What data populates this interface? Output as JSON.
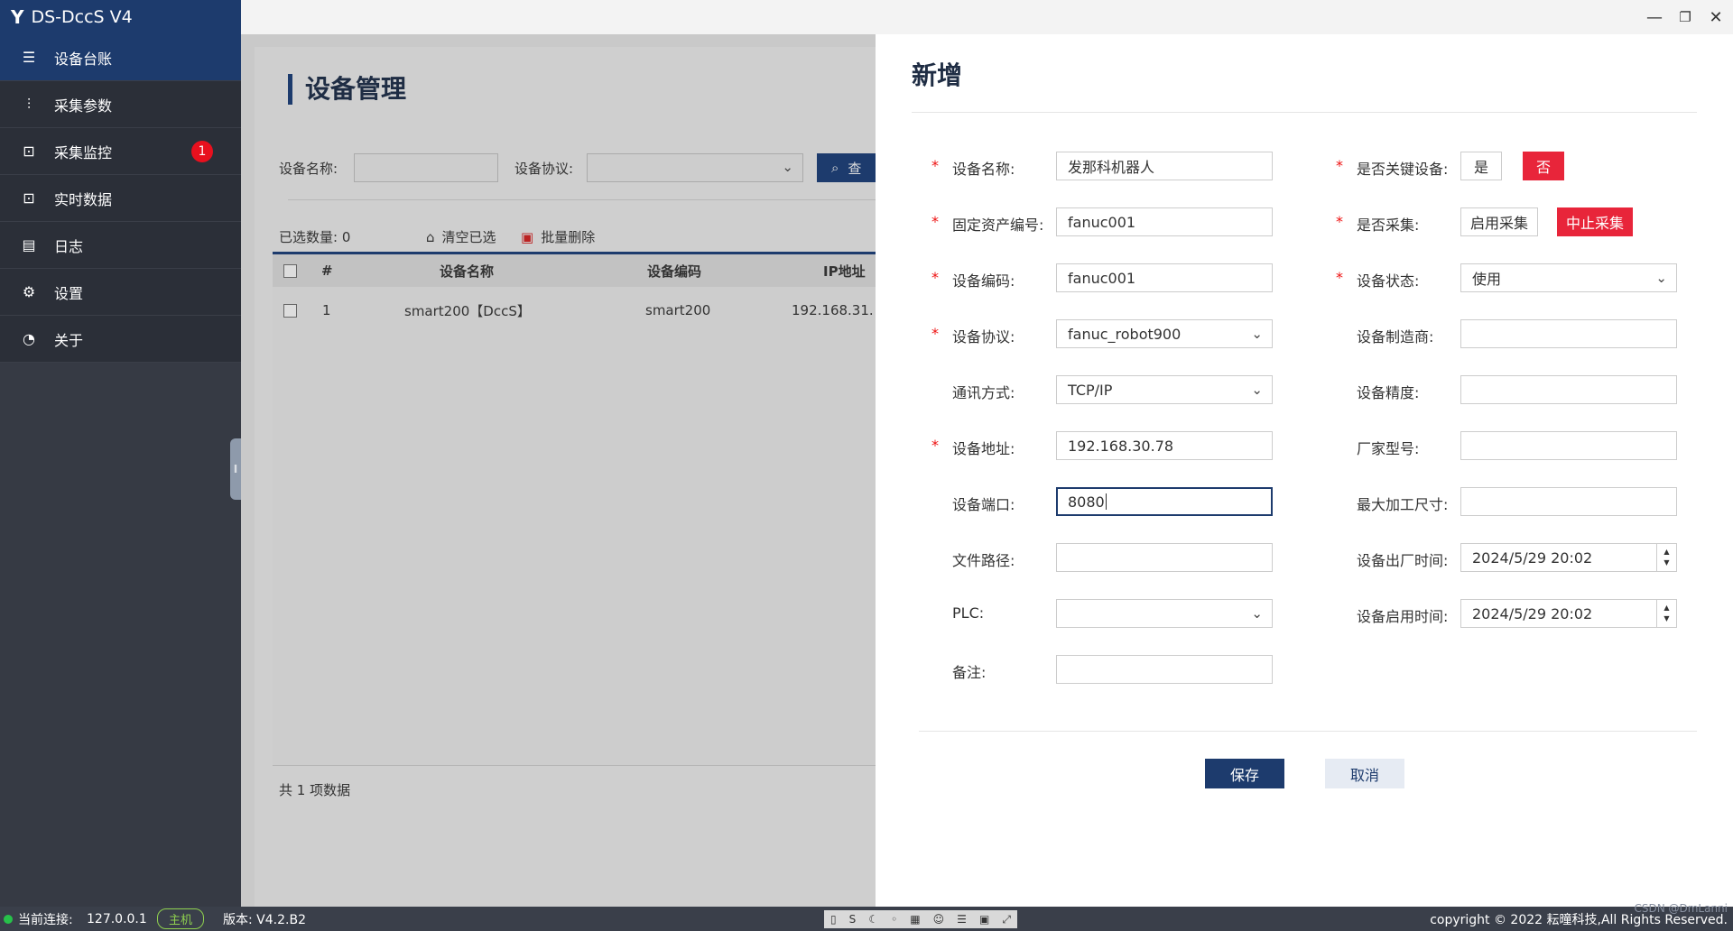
{
  "app": {
    "title": "DS-DccS V4",
    "logo_glyph": "Y"
  },
  "window_controls": {
    "minimize": "—",
    "restore": "❐",
    "close": "✕"
  },
  "sidebar": {
    "items": [
      {
        "label": "设备台账",
        "icon": "ledger-icon",
        "glyph": "☰",
        "active": true
      },
      {
        "label": "采集参数",
        "icon": "sliders-icon",
        "glyph": "⫶"
      },
      {
        "label": "采集监控",
        "icon": "monitor-icon",
        "glyph": "⊡",
        "badge": "1"
      },
      {
        "label": "实时数据",
        "icon": "chart-icon",
        "glyph": "⊡"
      },
      {
        "label": "日志",
        "icon": "calendar-icon",
        "glyph": "▤"
      },
      {
        "label": "设置",
        "icon": "gear-icon",
        "glyph": "⚙"
      },
      {
        "label": "关于",
        "icon": "info-icon",
        "glyph": "◔"
      }
    ]
  },
  "main": {
    "title": "设备管理",
    "filters": {
      "name_label": "设备名称:",
      "protocol_label": "设备协议:",
      "search_label": "查"
    },
    "toolbar": {
      "selected_count": "已选数量: 0",
      "clear_label": "清空已选",
      "batch_delete_label": "批量删除"
    },
    "table": {
      "headers": [
        "#",
        "设备名称",
        "设备编码",
        "IP地址"
      ],
      "rows": [
        {
          "index": "1",
          "name": "smart200【DccS】",
          "code": "smart200",
          "ip": "192.168.31."
        }
      ]
    },
    "footer": "共 1 项数据"
  },
  "dialog": {
    "title": "新增",
    "left_fields": [
      {
        "label": "设备名称:",
        "value": "发那科机器人",
        "required": true,
        "type": "input"
      },
      {
        "label": "固定资产编号:",
        "value": "fanuc001",
        "required": true,
        "type": "input"
      },
      {
        "label": "设备编码:",
        "value": "fanuc001",
        "required": true,
        "type": "input"
      },
      {
        "label": "设备协议:",
        "value": "fanuc_robot900",
        "required": true,
        "type": "select"
      },
      {
        "label": "通讯方式:",
        "value": "TCP/IP",
        "required": false,
        "type": "select"
      },
      {
        "label": "设备地址:",
        "value": "192.168.30.78",
        "required": true,
        "type": "input"
      },
      {
        "label": "设备端口:",
        "value": "8080",
        "required": false,
        "type": "input",
        "focused": true
      },
      {
        "label": "文件路径:",
        "value": "",
        "required": false,
        "type": "input"
      },
      {
        "label": "PLC:",
        "value": "",
        "required": false,
        "type": "select"
      },
      {
        "label": "备注:",
        "value": "",
        "required": false,
        "type": "input"
      }
    ],
    "right_fields": {
      "key_device": {
        "label": "是否关键设备:",
        "yes": "是",
        "no": "否",
        "selected": "否"
      },
      "collect": {
        "label": "是否采集:",
        "enable": "启用采集",
        "stop": "中止采集",
        "selected": "中止采集"
      },
      "status": {
        "label": "设备状态:",
        "value": "使用"
      },
      "manufacturer": {
        "label": "设备制造商:",
        "value": ""
      },
      "precision": {
        "label": "设备精度:",
        "value": ""
      },
      "model": {
        "label": "厂家型号:",
        "value": ""
      },
      "max_size": {
        "label": "最大加工尺寸:",
        "value": ""
      },
      "factory_time": {
        "label": "设备出厂时间:",
        "value": "2024/5/29 20:02"
      },
      "enable_time": {
        "label": "设备启用时间:",
        "value": "2024/5/29 20:02"
      }
    },
    "save_label": "保存",
    "cancel_label": "取消",
    "required_mark": "*"
  },
  "statusbar": {
    "connection_label": "当前连接:",
    "connection_value": "127.0.0.1",
    "host_badge": "主机",
    "version": "版本: V4.2.B2",
    "copyright": "copyright © 2022 耘曈科技,All Rights Reserved.",
    "watermark": "CSDN @DmLanni"
  },
  "colors": {
    "brand": "#1d3b6d",
    "danger": "#e8253a",
    "sidebar_bg": "#363a44",
    "online": "#27c14a"
  }
}
